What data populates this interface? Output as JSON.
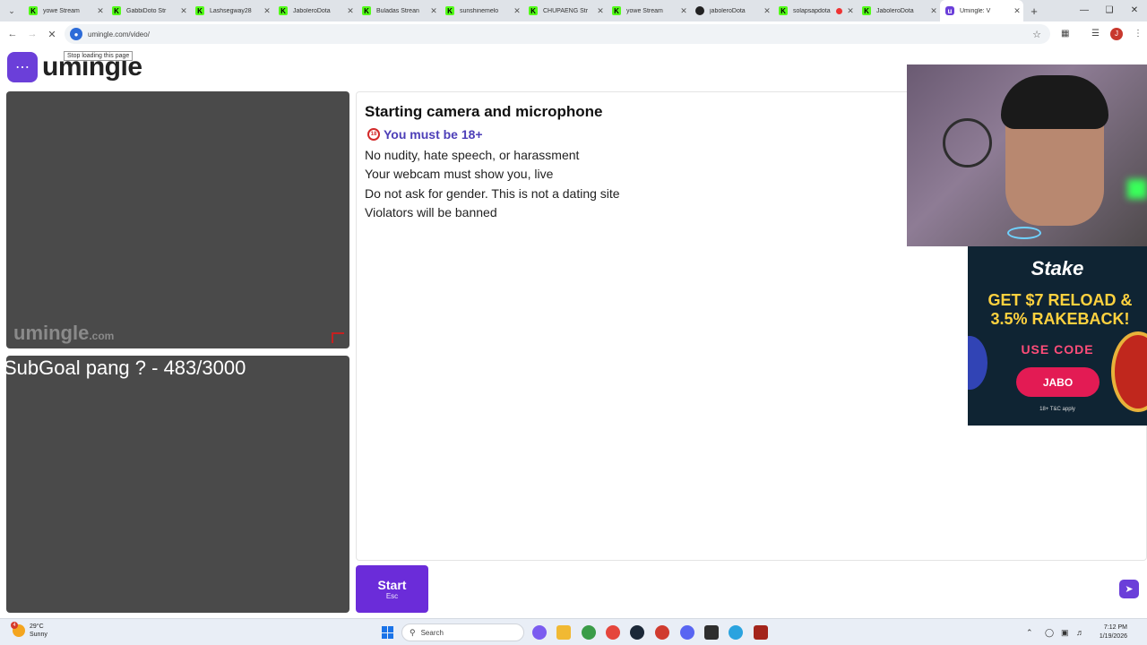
{
  "browser": {
    "tabs": [
      {
        "title": "yowe Stream",
        "favicon": "kick-icon",
        "active": false
      },
      {
        "title": "GabbiDoto Str",
        "favicon": "kick-icon",
        "active": false
      },
      {
        "title": "Lashsegway28",
        "favicon": "kick-icon",
        "active": false
      },
      {
        "title": "JaboleroDota",
        "favicon": "kick-icon",
        "active": false
      },
      {
        "title": "Buladas Strean",
        "favicon": "kick-icon",
        "active": false
      },
      {
        "title": "sunshinemelo",
        "favicon": "kick-icon",
        "active": false
      },
      {
        "title": "CHUPAENG Str",
        "favicon": "kick-icon",
        "active": false
      },
      {
        "title": "yowe Stream",
        "favicon": "kick-icon",
        "active": false
      },
      {
        "title": "jaboleroDota",
        "favicon": "github-icon",
        "active": false
      },
      {
        "title": "solapsapdota",
        "favicon": "kick-icon",
        "active": false,
        "recording": true
      },
      {
        "title": "JaboleroDota",
        "favicon": "kick-icon",
        "active": false
      },
      {
        "title": "Umingle: V",
        "favicon": "umingle-icon",
        "active": true
      }
    ],
    "new_tab_label": "+",
    "url": "umingle.com/video/",
    "tooltip": "Stop loading this page",
    "profile_initial": "J"
  },
  "page": {
    "logo_text": "umingle",
    "watermark_main": "umingle",
    "watermark_suffix": ".com",
    "overlay_text": "SubGoal pang ? - 483/3000",
    "rules_title": "Starting camera and microphone",
    "age_warning": "You must be 18+",
    "age_icon_text": "18",
    "rules": [
      "No nudity, hate speech, or harassment",
      "Your webcam must show you, live",
      "Do not ask for gender. This is not a dating site",
      "Violators will be banned"
    ],
    "start_label": "Start",
    "start_key": "Esc",
    "chat_placeholder": ""
  },
  "ad": {
    "brand": "Stake",
    "headline": "GET $7 RELOAD & 3.5% RAKEBACK!",
    "code_label": "USE CODE",
    "button": "JABO",
    "fine_print": "18+ T&C apply"
  },
  "taskbar": {
    "weather_temp": "29°C",
    "weather_desc": "Sunny",
    "weather_badge": "4",
    "search_placeholder": "Search",
    "time": "7:12 PM",
    "date": "1/19/2026"
  },
  "colors": {
    "accent": "#6b2cd9",
    "brand_purple": "#6b3fd9",
    "video_bg": "#4a4a4a",
    "ad_button": "#e31b54",
    "ad_headline": "#ffd23f"
  }
}
